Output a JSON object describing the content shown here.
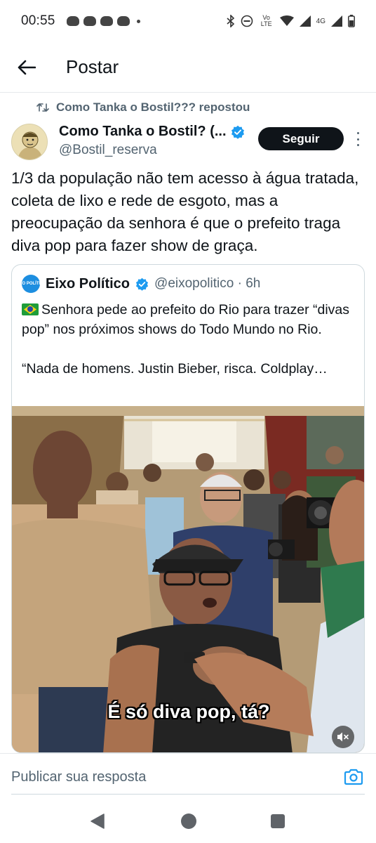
{
  "status_bar": {
    "time": "00:55",
    "network_label": "4G",
    "volte_label": "Vo LTE"
  },
  "header": {
    "title": "Postar"
  },
  "repost": {
    "text": "Como Tanka o Bostil??? repostou"
  },
  "author": {
    "name": "Como Tanka o Bostil? (...",
    "handle": "@Bostil_reserva",
    "follow_label": "Seguir"
  },
  "post": {
    "text": "1/3 da população não tem acesso à água tratada, coleta de lixo e rede de esgoto, mas a preocupação da senhora é que o prefeito traga diva pop para fazer show de graça."
  },
  "quote": {
    "avatar_text": "EIXO POLÍTICO",
    "name": "Eixo Político",
    "handle": "@eixopolitico · 6h",
    "line1": "Senhora pede ao prefeito do Rio para trazer “divas pop” nos próximos shows do Todo Mundo no Rio.",
    "line2": "“Nada de homens. Justin Bieber, risca. Coldplay…"
  },
  "video": {
    "caption": "É só diva pop, tá?"
  },
  "reply": {
    "placeholder": "Publicar sua resposta"
  },
  "colors": {
    "text_primary": "#0f1419",
    "text_secondary": "#536471",
    "verified": "#1d9bf0",
    "accent": "#1d9bf0",
    "follow_bg": "#0f1419"
  }
}
